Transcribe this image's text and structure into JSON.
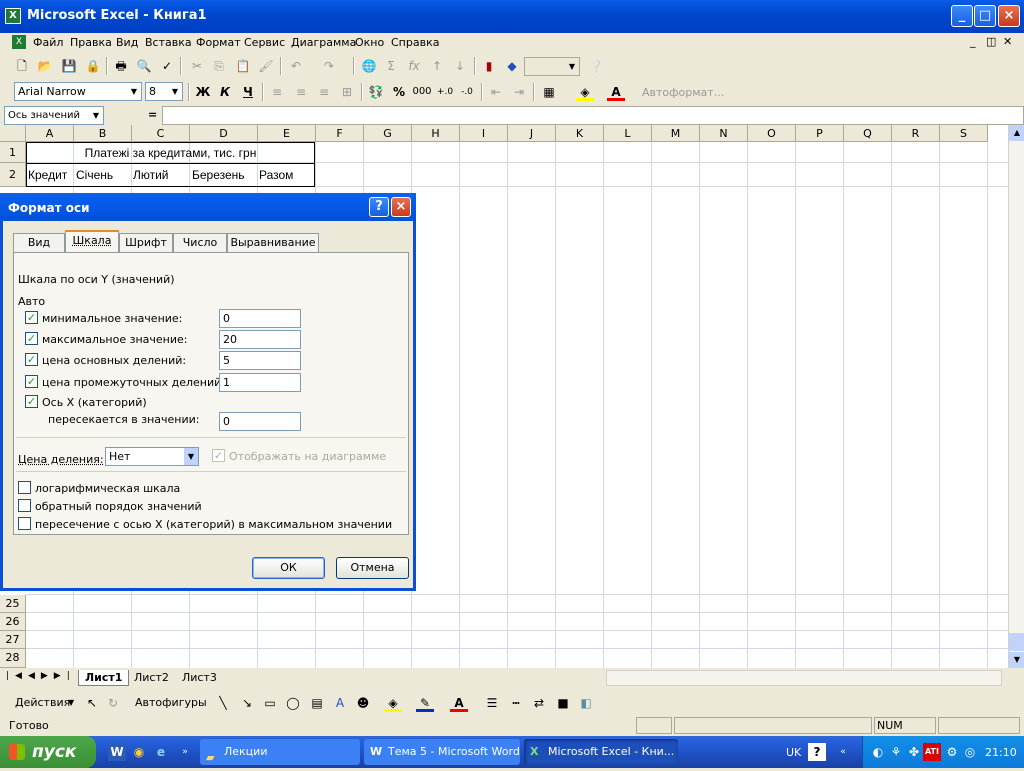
{
  "window": {
    "title": "Microsoft Excel - Книга1"
  },
  "menu": [
    "Файл",
    "Правка",
    "Вид",
    "Вставка",
    "Формат",
    "Сервис",
    "Диаграмма",
    "Окно",
    "Справка"
  ],
  "format_toolbar": {
    "font": "Arial Narrow",
    "size": "8",
    "bold": "Ж",
    "italic": "К",
    "underline": "Ч",
    "percent": "%",
    "thousands": "000",
    "autoformat": "Автоформат..."
  },
  "formula_bar": {
    "name_box": "Ось значений",
    "equals": "="
  },
  "columns": [
    "A",
    "B",
    "C",
    "D",
    "E",
    "F",
    "G",
    "H",
    "I",
    "J",
    "K",
    "L",
    "M",
    "N",
    "O",
    "P",
    "Q",
    "R",
    "S"
  ],
  "rows_top": [
    "1",
    "2"
  ],
  "rows_bottom": [
    "25",
    "26",
    "27",
    "28"
  ],
  "cells": {
    "title": "Платежі за кредитами, тис. грн",
    "a2": "Кредит",
    "b2": "Січень",
    "c2": "Лютий",
    "d2": "Березень",
    "e2": "Разом"
  },
  "dialog": {
    "title": "Формат оси",
    "tabs": [
      "Вид",
      "Шкала",
      "Шрифт",
      "Число",
      "Выравнивание"
    ],
    "section": "Шкала по оси Y (значений)",
    "auto": "Авто",
    "min_label": "минимальное значение:",
    "min_value": "0",
    "max_label": "максимальное значение:",
    "max_value": "20",
    "major_label": "цена основных делений:",
    "major_value": "5",
    "minor_label": "цена промежуточных делений:",
    "minor_value": "1",
    "xaxis_label": "Ось X (категорий)",
    "cross_label": "пересекается в значении:",
    "cross_value": "0",
    "unit_label": "Цена деления:",
    "unit_value": "Нет",
    "show_on_chart": "Отображать на диаграмме",
    "log_scale": "логарифмическая шкала",
    "reverse": "обратный порядок значений",
    "cross_max": "пересечение с осью X (категорий) в максимальном значении",
    "ok": "ОК",
    "cancel": "Отмена"
  },
  "sheet_tabs": [
    "Лист1",
    "Лист2",
    "Лист3"
  ],
  "drawing": {
    "actions": "Действия",
    "autoshapes": "Автофигуры"
  },
  "status": {
    "ready": "Готово",
    "num": "NUM"
  },
  "taskbar": {
    "start": "пуск",
    "tasks": [
      "Лекции",
      "Тема 5 - Microsoft Word",
      "Microsoft Excel - Кни..."
    ],
    "lang": "UK",
    "clock": "21:10"
  }
}
